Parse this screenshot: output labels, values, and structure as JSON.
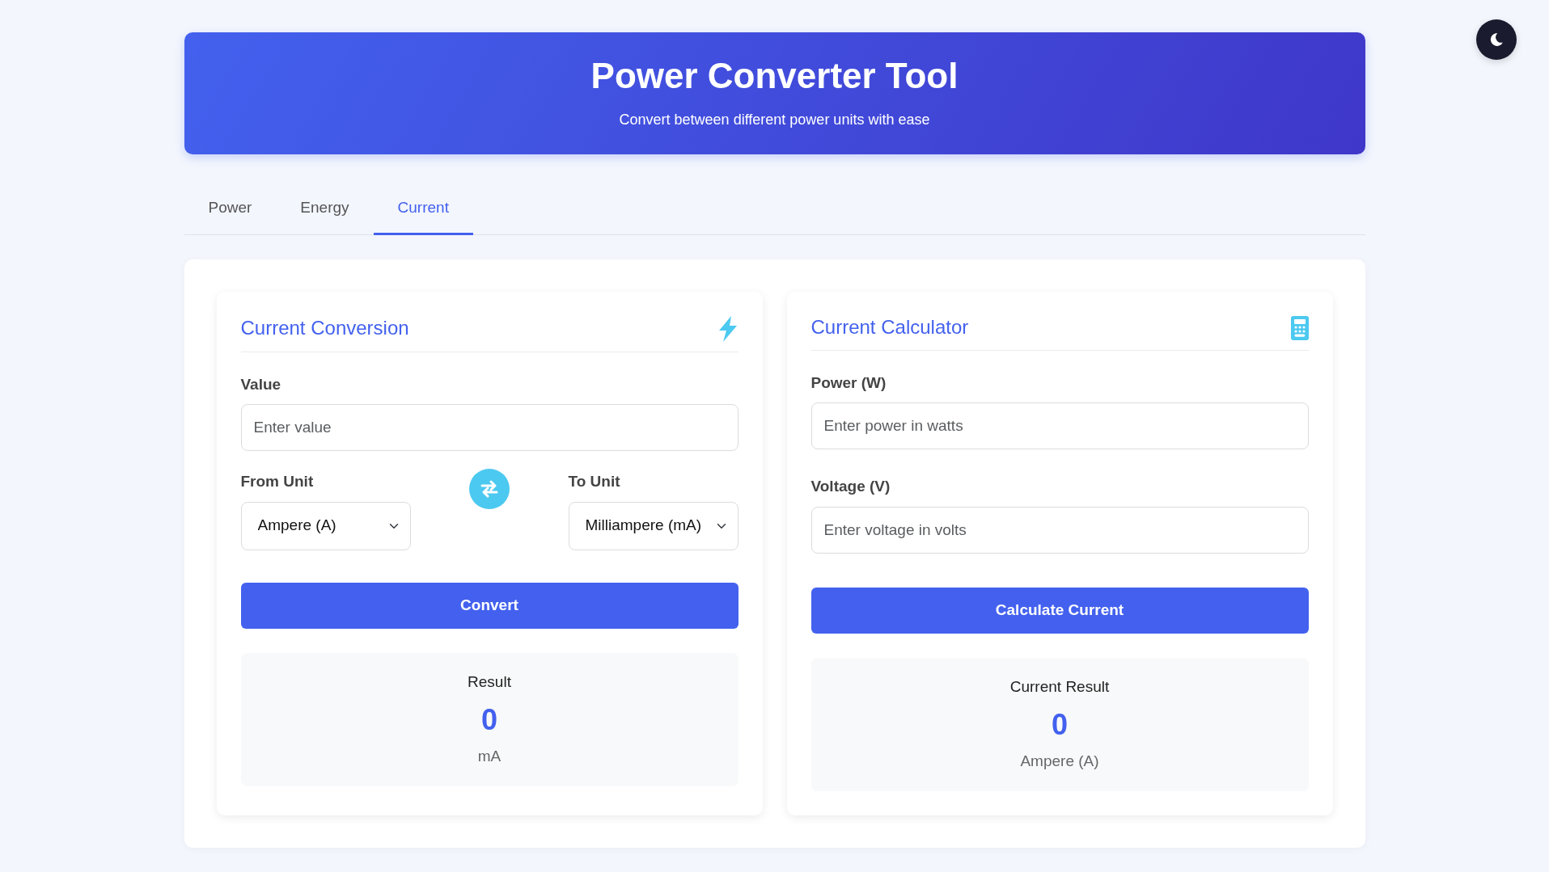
{
  "header": {
    "title": "Power Converter Tool",
    "subtitle": "Convert between different power units with ease"
  },
  "theme_toggle": {
    "dark": false
  },
  "tabs": [
    {
      "label": "Power",
      "selected": false
    },
    {
      "label": "Energy",
      "selected": false
    },
    {
      "label": "Current",
      "selected": true
    }
  ],
  "conversion": {
    "title": "Current Conversion",
    "value_label": "Value",
    "value_placeholder": "Enter value",
    "from_label": "From Unit",
    "from_value": "Ampere (A)",
    "to_label": "To Unit",
    "to_value": "Milliampere (mA)",
    "button": "Convert",
    "result_label": "Result",
    "result_value": "0",
    "result_unit": "mA"
  },
  "calculator": {
    "title": "Current Calculator",
    "fields": [
      {
        "label": "Power (W)",
        "placeholder": "Enter power in watts"
      },
      {
        "label": "Voltage (V)",
        "placeholder": "Enter voltage in volts"
      }
    ],
    "button": "Calculate Current",
    "result_label": "Current Result",
    "result_value": "0",
    "result_unit": "Ampere (A)"
  }
}
